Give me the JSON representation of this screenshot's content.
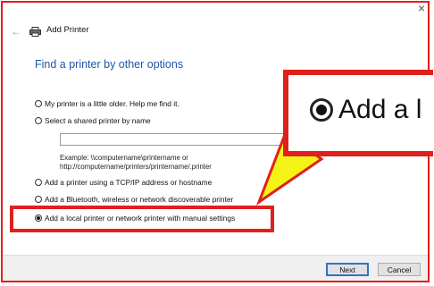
{
  "window": {
    "close_glyph": "×",
    "back_glyph": "←",
    "title": "Add Printer"
  },
  "heading": "Find a printer by other options",
  "options": [
    {
      "label": "My printer is a little older. Help me find it.",
      "selected": false
    },
    {
      "label": "Select a shared printer by name",
      "selected": false
    },
    {
      "label": "Add a printer using a TCP/IP address or hostname",
      "selected": false
    },
    {
      "label": "Add a Bluetooth, wireless or network discoverable printer",
      "selected": false
    },
    {
      "label": "Add a local printer or network printer with manual settings",
      "selected": true
    }
  ],
  "shared_printer_input": {
    "value": ""
  },
  "example": {
    "line1": "Example: \\\\computername\\printername or",
    "line2": "http://computername/printers/printername/.printer"
  },
  "buttons": {
    "next": "Next",
    "cancel": "Cancel"
  },
  "zoom_callout": {
    "text": "Add a l"
  },
  "colors": {
    "annotation_red": "#e0201b",
    "annotation_yellow": "#f3f317",
    "heading_blue": "#1c55a8"
  },
  "icons": [
    "close-icon",
    "back-arrow-icon",
    "printer-icon",
    "radio-button-icon"
  ]
}
